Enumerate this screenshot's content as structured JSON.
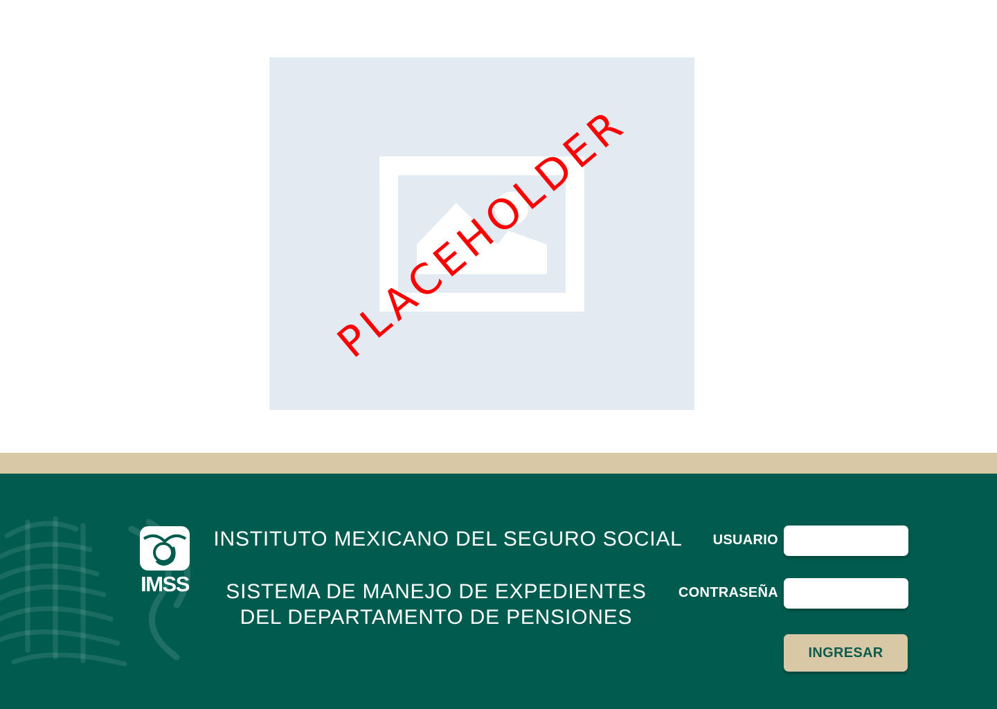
{
  "hero": {
    "stamp_text": "PLACEHOLDER",
    "icon": "image-placeholder-icon"
  },
  "header": {
    "logo_text": "IMSS",
    "institution": "INSTITUTO MEXICANO DEL SEGURO SOCIAL",
    "system_line1": "SISTEMA DE MANEJO DE EXPEDIENTES",
    "system_line2": "DEL DEPARTAMENTO DE PENSIONES"
  },
  "login": {
    "user_label": "USUARIO",
    "user_value": "",
    "password_label": "CONTRASEÑA",
    "password_value": "",
    "submit_label": "INGRESAR"
  },
  "colors": {
    "footer_bg": "#015c4f",
    "accent_tan": "#d9c8a6",
    "placeholder_bg": "#e2eaf2",
    "stamp_red": "#ff0000"
  }
}
